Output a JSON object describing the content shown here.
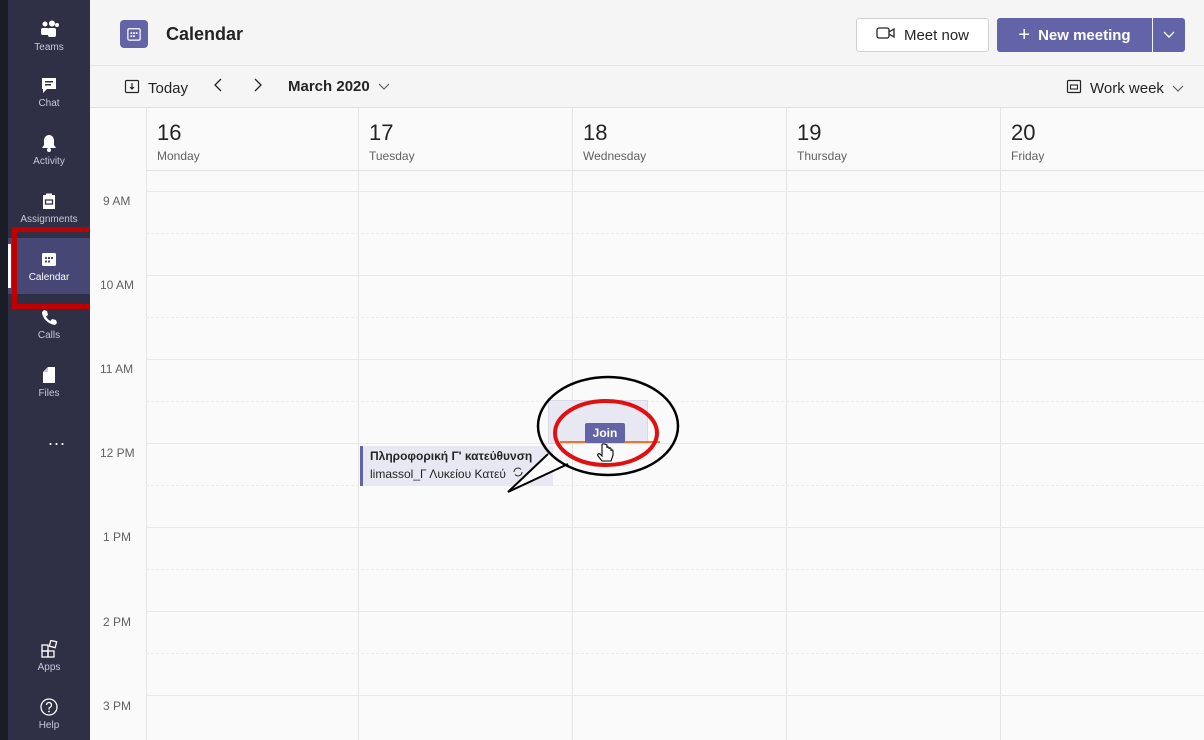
{
  "rail": {
    "items": [
      {
        "label": "Teams",
        "icon": "teams-icon"
      },
      {
        "label": "Chat",
        "icon": "chat-icon"
      },
      {
        "label": "Activity",
        "icon": "bell-icon"
      },
      {
        "label": "Assignments",
        "icon": "assignments-icon"
      },
      {
        "label": "Calendar",
        "icon": "calendar-icon",
        "active": true
      },
      {
        "label": "Calls",
        "icon": "phone-icon"
      },
      {
        "label": "Files",
        "icon": "file-icon"
      }
    ],
    "more": "...",
    "bottom": [
      {
        "label": "Apps",
        "icon": "apps-icon"
      },
      {
        "label": "Help",
        "icon": "help-icon"
      }
    ]
  },
  "header": {
    "title": "Calendar",
    "meet_now": "Meet now",
    "new_meeting": "New meeting"
  },
  "toolbar": {
    "today": "Today",
    "month": "March 2020",
    "view": "Work week"
  },
  "days": [
    {
      "num": "16",
      "name": "Monday"
    },
    {
      "num": "17",
      "name": "Tuesday"
    },
    {
      "num": "18",
      "name": "Wednesday"
    },
    {
      "num": "19",
      "name": "Thursday"
    },
    {
      "num": "20",
      "name": "Friday"
    }
  ],
  "times": [
    "9 AM",
    "10 AM",
    "11 AM",
    "12 PM",
    "1 PM",
    "2 PM",
    "3 PM"
  ],
  "event": {
    "title": "Πληροφορική Γ' κατεύθυνση",
    "subtitle": "limassol_Γ Λυκείου Κατεύ"
  },
  "popup": {
    "join": "Join"
  },
  "colors": {
    "rail_bg": "#2f3046",
    "accent": "#6264a7",
    "highlight": "#c00000",
    "now_line": "#e77735"
  }
}
